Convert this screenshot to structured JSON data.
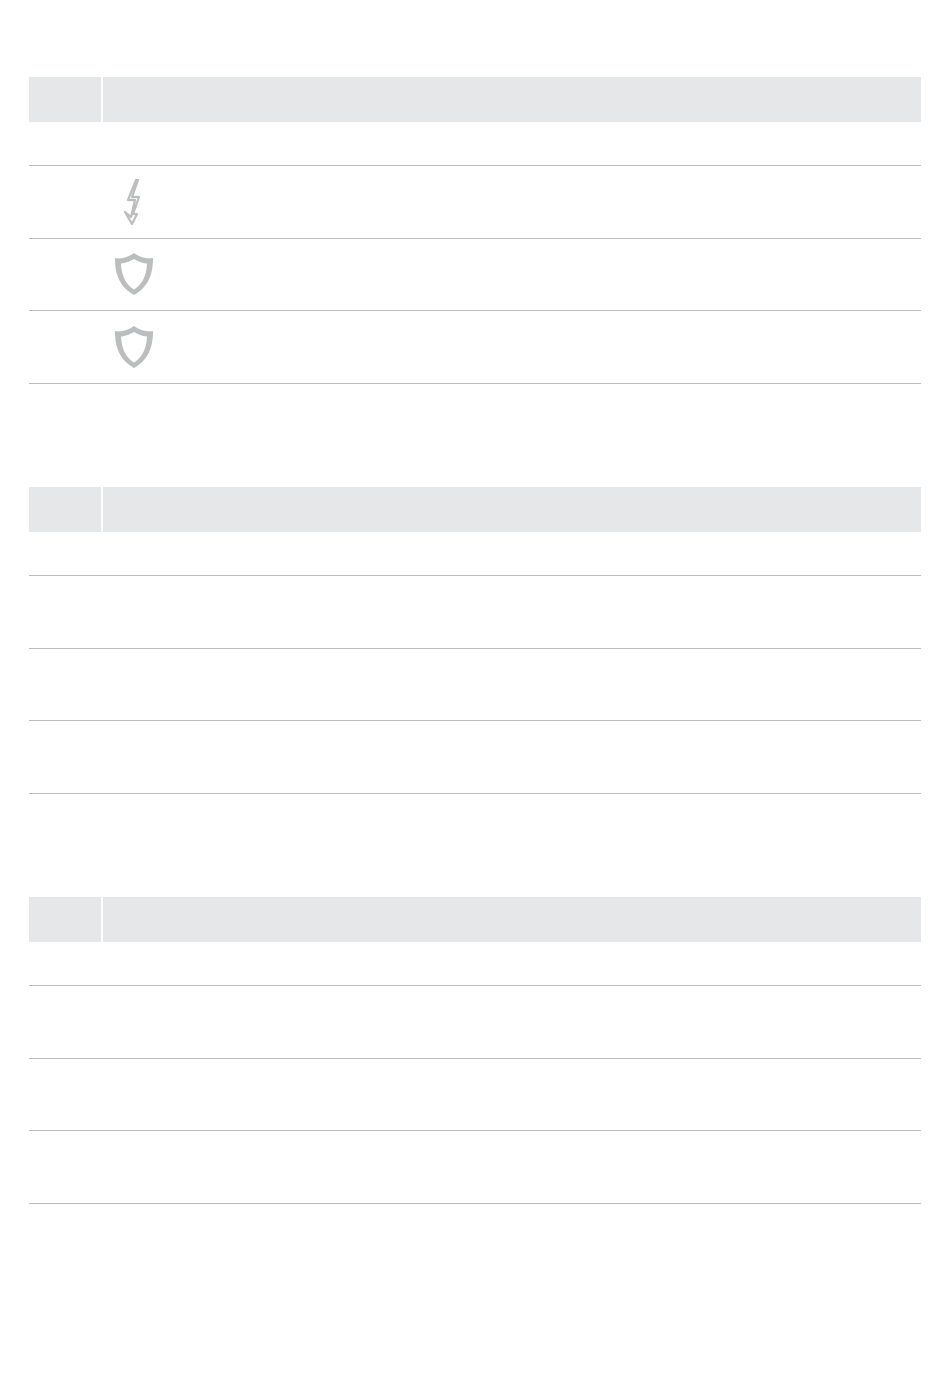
{
  "tables": [
    {
      "header": [
        "",
        ""
      ],
      "subheader": [
        "",
        ""
      ],
      "rows": [
        {
          "icon": "lightning-bolt-icon",
          "text": ""
        },
        {
          "icon": "shield-icon",
          "text": ""
        },
        {
          "icon": "shield-icon",
          "text": ""
        }
      ]
    },
    {
      "header": [
        "",
        ""
      ],
      "subheader": [
        "",
        ""
      ],
      "rows": [
        {
          "icon": "",
          "text": ""
        },
        {
          "icon": "",
          "text": ""
        },
        {
          "icon": "",
          "text": ""
        }
      ]
    },
    {
      "header": [
        "",
        ""
      ],
      "subheader": [
        "",
        ""
      ],
      "rows": [
        {
          "icon": "",
          "text": ""
        },
        {
          "icon": "",
          "text": ""
        },
        {
          "icon": "",
          "text": ""
        }
      ]
    }
  ],
  "colors": {
    "header_fill": "#e6e7e8",
    "rule": "#bcbdbf",
    "icon": "#bcbdbf"
  }
}
